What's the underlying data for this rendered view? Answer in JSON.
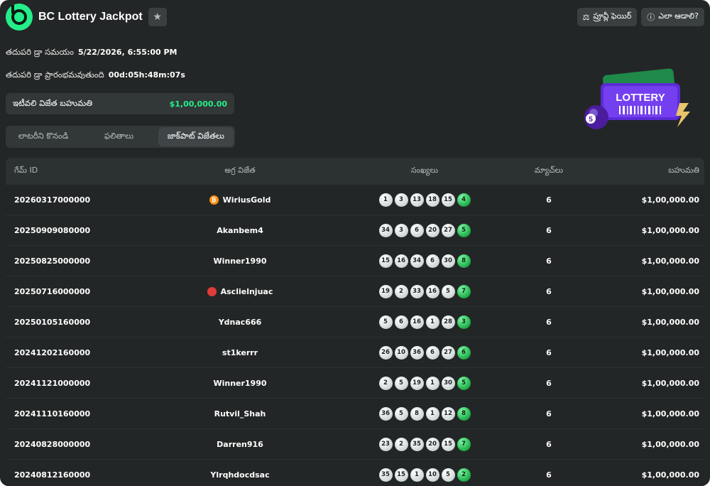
{
  "header": {
    "title": "BC Lottery Jackpot",
    "provably_fair": "ప్రూవ్లీ ఫెయిర్",
    "how_to_play": "ఎలా ఆడాలి?"
  },
  "info": {
    "next_draw_time_label": "తదుపరి డ్రా సమయం",
    "next_draw_time": "5/22/2026, 6:55:00 PM",
    "next_draw_starts_label": "తదుపరి డ్రా ప్రారంభమవుతుంది",
    "next_draw_starts": "00d:05h:48m:07s",
    "latest_prize_label": "ఇటీవలి విజేత బహుమతి",
    "latest_prize": "$1,00,000.00"
  },
  "tabs": [
    {
      "label": "లాటరీని కొనండి"
    },
    {
      "label": "ఫలితాలు"
    },
    {
      "label": "జాక్‌పాట్ విజేతలు"
    }
  ],
  "art": {
    "lottery_text": "LOTTERY",
    "ball_number": "5"
  },
  "table": {
    "headers": [
      "గేమ్ ID",
      "అగ్ర విజేత",
      "సంఖ్యలు",
      "మ్యాచ్‌లు",
      "బహుమతి"
    ],
    "rows": [
      {
        "game_id": "20260317000000",
        "winner": "WiriusGold",
        "winner_icon": "bitcoin-icon",
        "numbers": [
          "1",
          "3",
          "13",
          "18",
          "15"
        ],
        "bonus": "4",
        "matches": "6",
        "prize": "$1,00,000.00"
      },
      {
        "game_id": "20250909080000",
        "winner": "Akanbem4",
        "winner_icon": "",
        "numbers": [
          "34",
          "3",
          "6",
          "20",
          "27"
        ],
        "bonus": "5",
        "matches": "6",
        "prize": "$1,00,000.00"
      },
      {
        "game_id": "20250825000000",
        "winner": "Winner1990",
        "winner_icon": "",
        "numbers": [
          "15",
          "16",
          "34",
          "6",
          "30"
        ],
        "bonus": "8",
        "matches": "6",
        "prize": "$1,00,000.00"
      },
      {
        "game_id": "20250716000000",
        "winner": "Asclielnjuac",
        "winner_icon": "avatar-icon",
        "numbers": [
          "19",
          "2",
          "33",
          "16",
          "5"
        ],
        "bonus": "7",
        "matches": "6",
        "prize": "$1,00,000.00"
      },
      {
        "game_id": "20250105160000",
        "winner": "Ydnac666",
        "winner_icon": "",
        "numbers": [
          "5",
          "6",
          "16",
          "1",
          "28"
        ],
        "bonus": "3",
        "matches": "6",
        "prize": "$1,00,000.00"
      },
      {
        "game_id": "20241202160000",
        "winner": "st1kerrr",
        "winner_icon": "",
        "numbers": [
          "26",
          "10",
          "36",
          "6",
          "27"
        ],
        "bonus": "6",
        "matches": "6",
        "prize": "$1,00,000.00"
      },
      {
        "game_id": "20241121000000",
        "winner": "Winner1990",
        "winner_icon": "",
        "numbers": [
          "2",
          "5",
          "19",
          "1",
          "30"
        ],
        "bonus": "5",
        "matches": "6",
        "prize": "$1,00,000.00"
      },
      {
        "game_id": "20241110160000",
        "winner": "Rutvil_Shah",
        "winner_icon": "",
        "numbers": [
          "36",
          "5",
          "8",
          "1",
          "12"
        ],
        "bonus": "8",
        "matches": "6",
        "prize": "$1,00,000.00"
      },
      {
        "game_id": "20240828000000",
        "winner": "Darren916",
        "winner_icon": "",
        "numbers": [
          "23",
          "2",
          "35",
          "20",
          "15"
        ],
        "bonus": "7",
        "matches": "6",
        "prize": "$1,00,000.00"
      },
      {
        "game_id": "20240812160000",
        "winner": "Ylrqhdocdsac",
        "winner_icon": "",
        "numbers": [
          "35",
          "15",
          "1",
          "10",
          "5"
        ],
        "bonus": "2",
        "matches": "6",
        "prize": "$1,00,000.00"
      }
    ]
  },
  "colors": {
    "accent": "#24ee89",
    "background": "#232626",
    "panel": "#323738"
  }
}
